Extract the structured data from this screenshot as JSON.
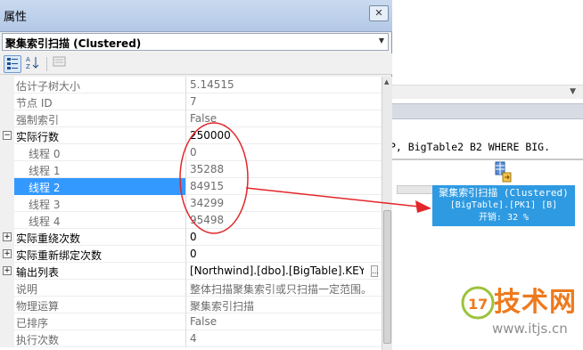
{
  "window": {
    "title": "属性",
    "close_glyph": "▫"
  },
  "object_selector": {
    "value": "聚集索引扫描 (Clustered)"
  },
  "toolbar": {
    "categorized": "categorized-icon",
    "alphabetical": "sort-az-icon",
    "property_pages": "property-pages-icon"
  },
  "properties": [
    {
      "name": "估计子树大小",
      "value": "5.14515"
    },
    {
      "name": "节点 ID",
      "value": "7"
    },
    {
      "name": "强制索引",
      "value": "False"
    },
    {
      "name": "实际行数",
      "value": "250000",
      "expander": "⊟"
    },
    {
      "name": "线程 0",
      "value": "0"
    },
    {
      "name": "线程 1",
      "value": "35288"
    },
    {
      "name": "线程 2",
      "value": "84915"
    },
    {
      "name": "线程 3",
      "value": "34299"
    },
    {
      "name": "线程 4",
      "value": "95498"
    },
    {
      "name": "实际重绕次数",
      "value": "0",
      "expander": "⊞"
    },
    {
      "name": "实际重新绑定次数",
      "value": "0",
      "expander": "⊞"
    },
    {
      "name": "输出列表",
      "value": "[Northwind].[dbo].[BigTable].KEY, [",
      "expander": "⊞"
    },
    {
      "name": "说明",
      "value": "整体扫描聚集索引或只扫描一定范围。"
    },
    {
      "name": "物理运算",
      "value": "聚集索引扫描"
    },
    {
      "name": "已排序",
      "value": "False"
    },
    {
      "name": "执行次数",
      "value": "4"
    }
  ],
  "plan": {
    "sql_text": "P, BigTable2 B2 WHERE BIG.",
    "node_line1": "聚集索引扫描 (Clustered)",
    "node_line2": "[BigTable].[PK1] [B]",
    "node_line3": "开销: 32 %"
  },
  "watermark": {
    "brand": "技术网",
    "url": "www.itjs.cn",
    "logo_text": "17"
  },
  "colors": {
    "highlight": "#3399ff",
    "annotation": "#e3262b",
    "node_bg": "#2e9ae2",
    "brand": "#ee7a1e"
  }
}
